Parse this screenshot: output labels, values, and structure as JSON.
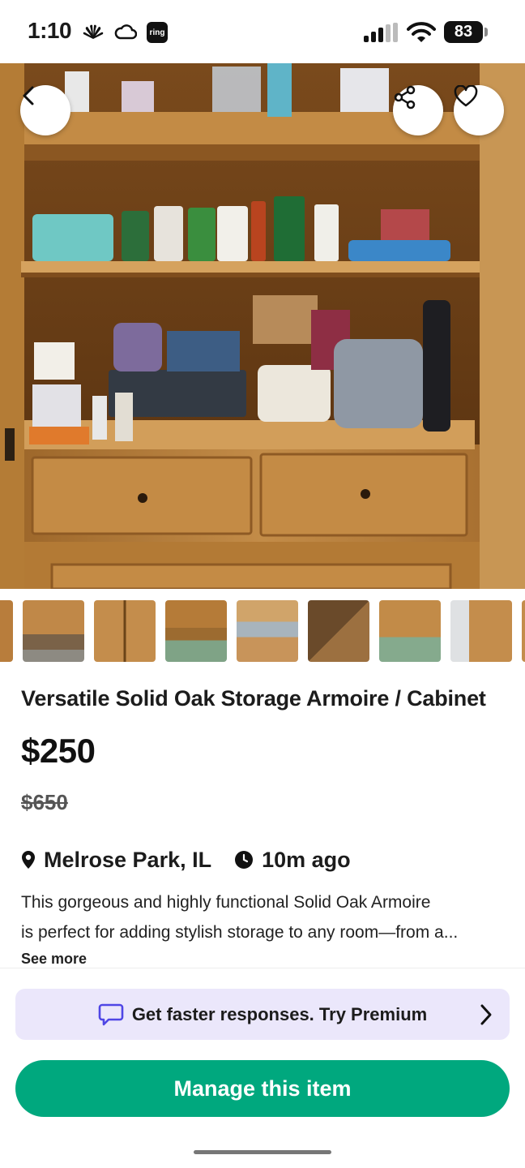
{
  "status_bar": {
    "time": "1:10",
    "ring_label": "ring",
    "battery": "83",
    "icons": [
      "nbc-peacock-icon",
      "cloud-icon",
      "ring-app-icon",
      "cellular-signal-icon",
      "wifi-icon",
      "battery-icon"
    ]
  },
  "hero": {
    "icons": [
      "back-chevron-icon",
      "share-icon",
      "heart-icon"
    ]
  },
  "listing": {
    "title": "Versatile Solid Oak Storage Armoire / Cabinet",
    "price": "$250",
    "original_price": "$650",
    "location": "Melrose Park, IL",
    "posted": "10m ago",
    "description_line_1": "This gorgeous and highly functional Solid Oak Armoire",
    "description_line_2": "is perfect for adding stylish storage to any room—from a...",
    "see_more": "See more"
  },
  "premium_banner": {
    "text": "Get faster responses. Try Premium"
  },
  "actions": {
    "manage": "Manage this item"
  },
  "colors": {
    "accent_green": "#00a87e",
    "premium_bg": "#ebe7fb",
    "premium_icon": "#4f46e5"
  }
}
